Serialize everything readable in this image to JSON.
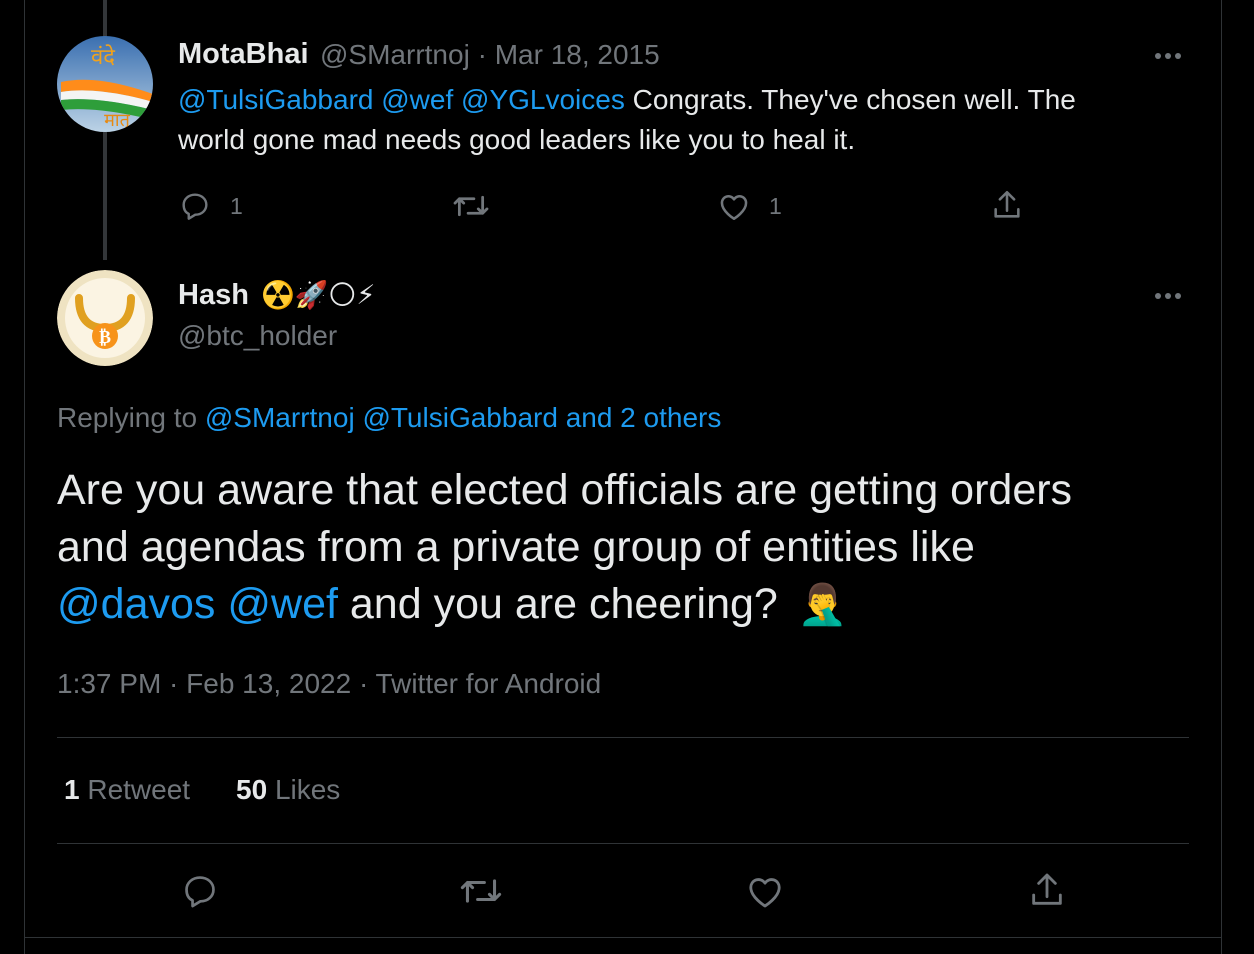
{
  "first_tweet": {
    "display_name": "MotaBhai",
    "handle": "@SMarrtnoj",
    "separator": "·",
    "date": "Mar 18, 2015",
    "mentions": [
      "@TulsiGabbard",
      "@wef",
      "@YGLvoices"
    ],
    "text_line1": "Congrats. They've chosen well. The",
    "text_line2": "world gone mad needs good leaders like you to heal it.",
    "reply_count": "1",
    "like_count": "1",
    "avatar_text_top": "वंदे",
    "avatar_text_bottom": "मातृ"
  },
  "main_tweet": {
    "display_name": "Hash",
    "name_emojis": "☢️🚀🌕⚡",
    "handle": "@btc_holder",
    "replying_prefix": "Replying to",
    "replying_to": "@SMarrtnoj @TulsiGabbard and 2 others",
    "text_line1": "Are you aware that elected officials are getting orders",
    "text_line2": "and agendas from a private group of entities like",
    "mention1": "@davos",
    "mention2": "@wef",
    "text_line3_rest": "and you are cheering?",
    "emoji": "🤦‍♂️",
    "timestamp": "1:37 PM · Feb 13, 2022 · Twitter for Android",
    "retweet_count": "1",
    "retweet_label": "Retweet",
    "likes_count": "50",
    "likes_label": "Likes",
    "avatar_glyph": "₿"
  },
  "colors": {
    "background": "#000000",
    "text": "#e7e9ea",
    "muted": "#71767b",
    "link": "#1d9bf0",
    "border": "#2f3336"
  },
  "icons": [
    "reply-icon",
    "retweet-icon",
    "like-icon",
    "share-icon",
    "more-icon"
  ]
}
